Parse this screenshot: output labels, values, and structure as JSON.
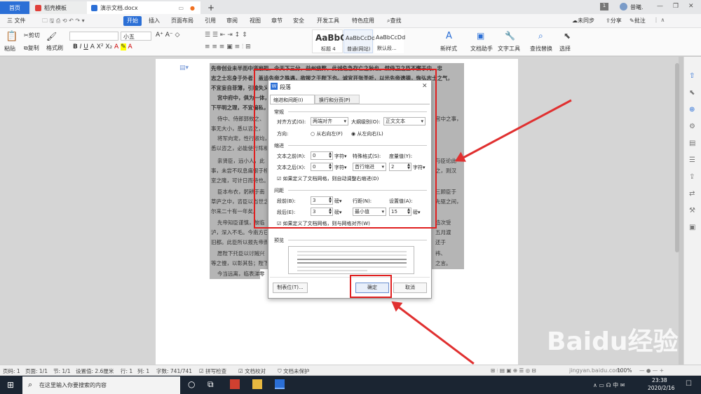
{
  "tabs": {
    "home": "首页",
    "template": "稻壳模板",
    "doc": "演示文档.docx",
    "add": "+"
  },
  "topright": {
    "page_indicator": "1",
    "user": "昔曦.",
    "minimize": "—",
    "restore": "❐",
    "close": "✕"
  },
  "menu": {
    "file": "三 文件",
    "start": "开始",
    "items": [
      "插入",
      "页面布局",
      "引用",
      "审阅",
      "视图",
      "章节",
      "安全",
      "开发工具",
      "特色应用"
    ],
    "search": "查找",
    "sync": "未同步",
    "share": "分享",
    "batch": "批注"
  },
  "ribbon": {
    "paste": "粘贴",
    "cut": "剪切",
    "copy": "复制",
    "format_painter": "格式刷",
    "font_size": "小五",
    "styles": [
      {
        "sample": "AaBbC",
        "label": "标题 4"
      },
      {
        "sample": "AaBbCcDd",
        "label": "普通(网站)"
      },
      {
        "sample": "AaBbCcDd",
        "label": "默认段..."
      }
    ],
    "new_style": "新样式",
    "doc_helper": "文档助手",
    "text_tools": "文字工具",
    "find_replace": "查找替换",
    "select": "选择"
  },
  "document": {
    "lines": [
      "先帝创业未半而中道崩殂，今天下三分，益州疲弊，此诚危急存亡之秋也。然侍卫之臣不懈于内，忠",
      "志之士忘身于外者，盖追先帝之殊遇，欲报之于陛下也。诚宜开张圣听，以光先帝遗德，恢弘志士之气，",
      "不宜妄自菲薄，引喻失义，",
      "宫中府中，俱为一体，",
      "下平明之理，不宜偏私，",
      "侍中、侍郎郭攸之、",
      "事无大小，悉以咨之，",
      "将军向宠，性行淑均，",
      "悉以咨之，必能使行阵和",
      "亲贤臣，远小人，此",
      "事，未尝不叹息痛恨于桓",
      "室之隆，可计日而待也。",
      "臣本布衣，躬耕于南",
      "草庐之中，咨臣以当世之",
      "尔来二十有一年矣。",
      "先帝知臣谨慎，故临",
      "泸，深入不毛。今南方已",
      "旧都。此臣所以报先帝而",
      "愿陛下托臣以讨贼兴",
      "等之慢，以彰其咎；陛下",
      "今当远离，临表涕零"
    ],
    "right_fragments": [
      "宫中之事，",
      "与臣论此",
      "之，则汉",
      "三顾臣于",
      "先驱之间，",
      "造次受",
      "五月渡",
      "还于",
      "袆、",
      "之言。"
    ]
  },
  "dialog": {
    "title": "段落",
    "tab_indent": "缩进和间距(I)",
    "tab_breaks": "换行和分页(P)",
    "general": "常规",
    "align_label": "对齐方式(G):",
    "align_value": "两端对齐",
    "outline_label": "大纲级别(O):",
    "outline_value": "正文文本",
    "direction_label": "方向:",
    "rtl": "从右向左(F)",
    "ltr": "从左向右(L)",
    "indent": "缩进",
    "before_text": "文本之前(R):",
    "before_val": "0",
    "after_text": "文本之后(X):",
    "after_val": "0",
    "unit_char": "字符",
    "special_label": "特殊格式(S):",
    "special_value": "首行缩进",
    "measure_label": "度量值(Y):",
    "measure_value": "2",
    "auto_indent": "如果定义了文档网格，则自动调整右缩进(D)",
    "spacing": "间距",
    "before_para": "段前(B):",
    "before_para_val": "3",
    "after_para": "段后(E):",
    "after_para_val": "3",
    "unit_pound": "磅",
    "line_spacing_label": "行距(N):",
    "line_spacing_value": "最小值",
    "set_value_label": "设置值(A):",
    "set_value": "15",
    "grid_align": "如果定义了文档网格，则与网格对齐(W)",
    "preview": "预览",
    "tabs_button": "制表位(T)...",
    "ok": "确定",
    "cancel": "取消"
  },
  "status": {
    "page_num": "页码: 1",
    "pages": "页面: 1/1",
    "section": "节: 1/1",
    "set_value": "设置值: 2.6厘米",
    "row": "行: 1",
    "col": "列: 1",
    "words": "字数: 741/741",
    "spell": "拼写检查",
    "proof": "文档校对",
    "protect": "文档未保护",
    "zoom": "100%"
  },
  "taskbar": {
    "search_placeholder": "在这里输入你要搜索的内容",
    "time": "23:38",
    "date": "2020/2/16"
  },
  "watermark": "Baidu经验",
  "watermark_url": "jingyan.baidu.com",
  "colors": {
    "accent": "#2b6fd6",
    "highlight": "#b5b5b5",
    "annotation_red": "#e02020"
  }
}
